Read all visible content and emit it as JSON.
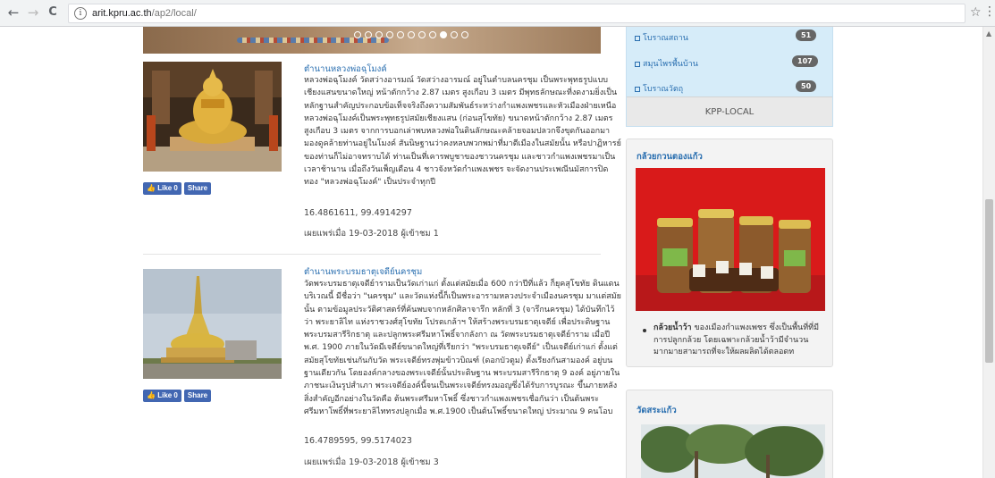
{
  "browser": {
    "url_host": "arit.kpru.ac.th",
    "url_path": "/ap2/local/",
    "back_icon": "←",
    "forward_icon": "→",
    "reload_icon": "C",
    "star_icon": "☆",
    "menu_icon": "⋮",
    "info_icon": "i"
  },
  "posts": [
    {
      "title": "ตำนานหลวงพ่อฉุโมงค์",
      "body": "หลวงพ่อฉุโมงค์ วัดสว่างอารมณ์ วัดสว่างอารมณ์ อยู่ในตำบลนครชุม เป็นพระพุทธรูปแบบเชียงแสนขนาดใหญ่ หน้าตักกว้าง 2.87 เมตร สูงเกือบ 3 เมตร มีพุทธลักษณะที่งดงามยิ่งเป็นหลักฐานสำคัญประกอบข้อเท็จจริงถึงความสัมพันธ์ระหว่างกำแพงเพชรและหัวเมืองฝ่ายเหนือ หลวงพ่อฉุโมงค์เป็นพระพุทธรูปสมัยเชียงแสน (ก่อนสุโขทัย) ขนาดหน้าตักกว้าง 2.87 เมตร สูงเกือบ 3 เมตร จากการบอกเล่าพบหลวงพ่อในดินลักษณะคล้ายจอมปลวกจึงขุดกันออกมา มองดูคล้ายท่านอยู่ในโมงค์ สันนิษฐานว่าคงหลบพวกพม่าที่มาตีเมืองในสมัยนั้น หรือปาฏิหารย์ของท่านก็ไม่อาจทราบได้ ท่านเป็นที่เคารพบูชาของชาวนครชุม และชาวกำแพงเพชรมาเป็นเวลาช้านาน เมื่อถึงวันเพ็ญเดือน 4 ชาวจังหวัดกำแพงเพชร จะจัดงานประเพณีนมัสการปิดทอง \"หลวงพ่อฉุโมงค์\" เป็นประจำทุกปี",
      "coords": "16.4861611, 99.4914297",
      "meta": "เผยแพร่เมื่อ 19-03-2018 ผู้เข้าชม 1"
    },
    {
      "title": "ตำนานพระบรมธาตุเจดีย์นครชุม",
      "body": "วัดพระบรมธาตุเจดีย์ารามเป็นวัดเก่าแก่ ตั้งแต่สมัยเมื่อ 600 กว่าปีที่แล้ว ก็ยุคสุโขทัย ดินแดนบริเวณนี้ มีชื่อว่า \"นครชุม\" และวัดแห่งนี้ก็เป็นพระอารามหลวงประจำเมืองนครชุม มาแต่สมัยนั้น ตามข้อมูลประวัติศาสตร์ที่ค้นพบจากหลักศิลาจารึก หลักที่ 3 (จารึกนครชุม) ได้บันทึกไว้ว่า พระยาลิไท แห่งราชวงศ์สุโขทัย โปรดเกล้าฯ ให้สร้างพระบรมธาตุเจดีย์ เพื่อประดิษฐานพระบรมสารีริกธาตุ และปลูกพระศรีมหาโพธิ์จากลังกา ณ วัดพระบรมธาตุเจดีย์าราม เมื่อปี พ.ศ. 1900 ภายในวัดมีเจดีย์ขนาดใหญ่ที่เรียกว่า \"พระบรมธาตุเจดีย์\" เป็นเจดีย์เก่าแก่ ตั้งแต่สมัยสุโขทัยเช่นกันกับวัด พระเจดีย์ทรงพุ่มข้าวบิณฑ์ (ดอกบัวตูม) ตั้งเรียงกันสามองค์ อยู่บนฐานเดียวกัน โดยองค์กลางของพระเจดีย์นั้นประดิษฐาน พระบรมสารีริกธาตุ 9 องค์ อยู่ภายในภาชนะเงินรูปสำเภา พระเจดีย์องค์นี้จนเป็นพระเจดีย์ทรงมอญซึ่งได้รับการบูรณะ ขึ้นภายหลัง สิ่งสำคัญอีกอย่างในวัดคือ ต้นพระศรีมหาโพธิ์ ซึ่งชาวกำแพงเพชรเชื่อกันว่า เป็นต้นพระศรีมหาโพธิ์ที่พระยาลิไททรงปลูกเมื่อ พ.ศ.1900 เป็นต้นโพธิ์ขนาดใหญ่ ประมาณ 9 คนโอบ",
      "coords": "16.4789595, 99.5174023",
      "meta": "เผยแพร่เมื่อ 19-03-2018 ผู้เข้าชม 3"
    }
  ],
  "facebook": {
    "like_label": "Like 0",
    "share_label": "Share",
    "like_icon": "👍"
  },
  "sidebar": {
    "categories": [
      {
        "label": "โบราณสถาน",
        "count": "51"
      },
      {
        "label": "สมุนไพรพื้นบ้าน",
        "count": "107"
      },
      {
        "label": "โบราณวัตถุ",
        "count": "50"
      }
    ],
    "footer_label": "KPP-LOCAL",
    "box1": {
      "title": "กล้วยกวนตองแก้ว",
      "item_bold": "กล้วยน้ำว้า",
      "item_text": " ของเมืองกำแพงเพชร ซึ่งเป็นพื้นที่ที่มีการปลูกกล้วย โดยเฉพาะกล้วยน้ำว้ามีจำนวนมากมายสามารถที่จะให้ผลผลิตได้ตลอดท"
    },
    "box2": {
      "title": "วัดสระแก้ว"
    }
  }
}
